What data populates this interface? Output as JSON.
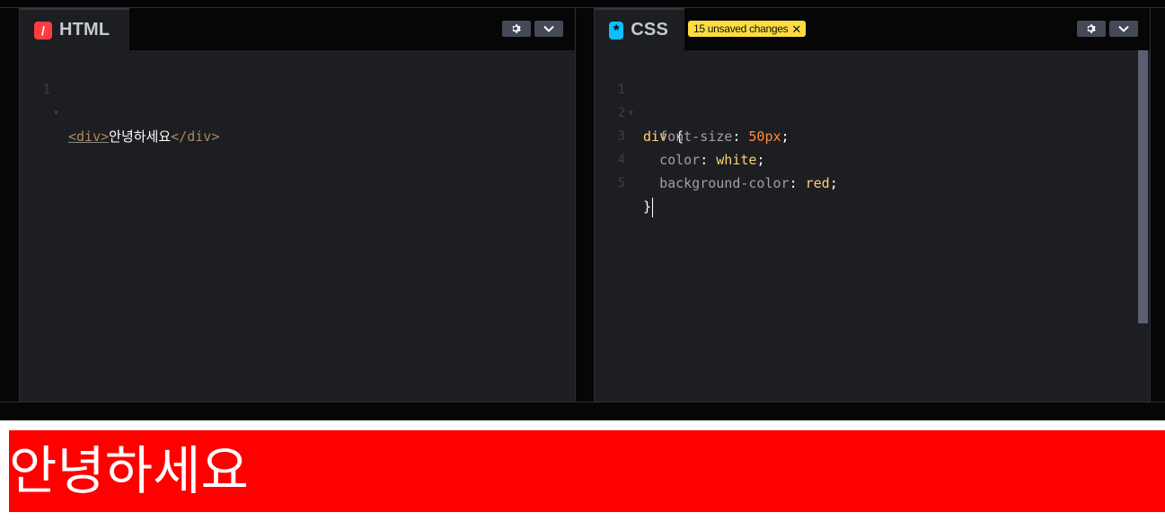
{
  "editors": {
    "html": {
      "title": "HTML",
      "icon": "html-slash-icon",
      "line_numbers": [
        "1"
      ],
      "code": {
        "open_tag": "<div>",
        "text": "안녕하세요",
        "close_tag": "</div>"
      }
    },
    "css": {
      "title": "CSS",
      "icon": "css-asterisk-icon",
      "badge": "15 unsaved changes",
      "line_numbers": [
        "1",
        "2",
        "3",
        "4",
        "5"
      ],
      "code": {
        "selector": "div",
        "open_brace": " {",
        "props": [
          {
            "name": "font-size",
            "value": "50px",
            "kind": "num"
          },
          {
            "name": "color",
            "value": "white",
            "kind": "val"
          },
          {
            "name": "background-color",
            "value": "red",
            "kind": "val"
          }
        ],
        "close_brace": "}"
      }
    }
  },
  "result": {
    "text": "안녕하세요",
    "text_color": "#ffffff",
    "background": "#ff0000"
  },
  "colors": {
    "badge": "#ffdd40",
    "html_icon": "#ff3c41",
    "css_icon": "#0ebeff",
    "editor_bg": "#1d1e22"
  }
}
